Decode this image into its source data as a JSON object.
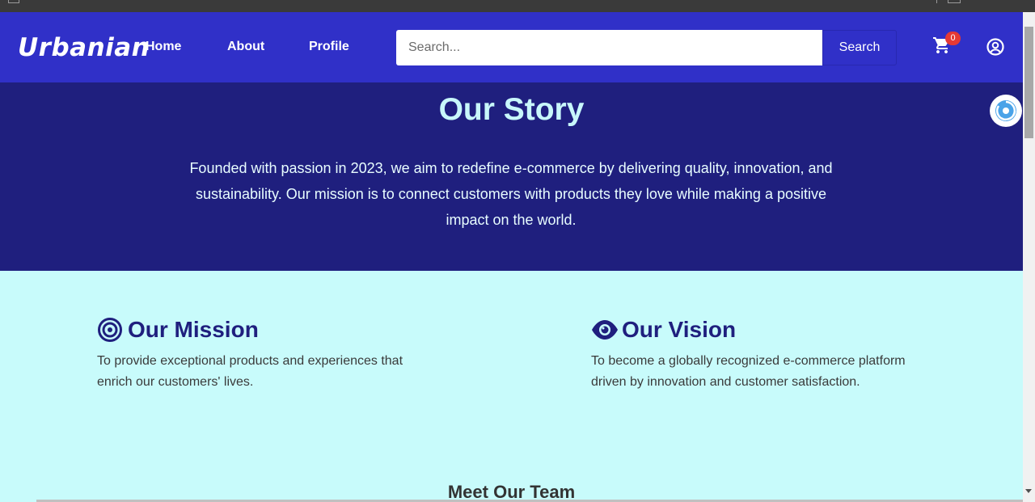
{
  "nav": {
    "logo": "Urbanian",
    "links": [
      "Home",
      "About",
      "Profile"
    ],
    "search_placeholder": "Search...",
    "search_button": "Search",
    "cart_count": "0",
    "icons": {
      "cart": "cart-icon",
      "user": "user-circle-icon"
    }
  },
  "story": {
    "title": "Our Story",
    "text": "Founded with passion in 2023, we aim to redefine e-commerce by delivering quality, innovation, and sustainability. Our mission is to connect customers with products they love while making a positive impact on the world."
  },
  "mission": {
    "icon": "bullseye-icon",
    "title": "Our Mission",
    "text": "To provide exceptional products and experiences that enrich our customers' lives."
  },
  "vision": {
    "icon": "eye-icon",
    "title": "Our Vision",
    "text": "To become a globally recognized e-commerce platform driven by innovation and customer satisfaction."
  },
  "team": {
    "title": "Meet Our Team"
  },
  "colors": {
    "nav_bg": "#3030c8",
    "story_bg": "#1f1f7e",
    "page_bg": "#c8fbfb",
    "heading": "#1f1f7e",
    "badge": "#e53935"
  }
}
